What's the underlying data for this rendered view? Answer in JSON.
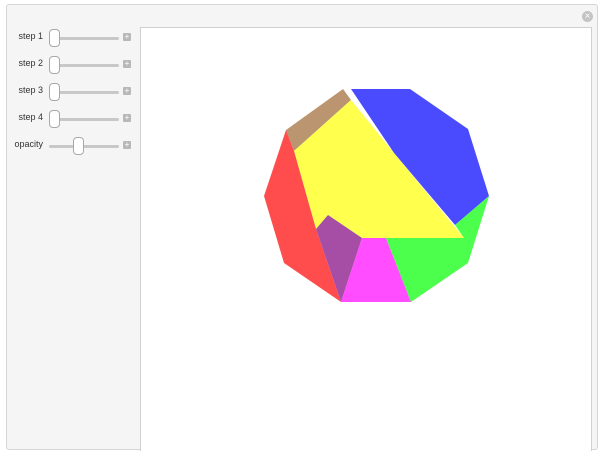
{
  "controls": [
    {
      "id": "step-1",
      "label": "step 1",
      "value": 0
    },
    {
      "id": "step-2",
      "label": "step 2",
      "value": 0
    },
    {
      "id": "step-3",
      "label": "step 3",
      "value": 0
    },
    {
      "id": "step-4",
      "label": "step 4",
      "value": 0
    },
    {
      "id": "opacity",
      "label": "opacity",
      "value": 0.4
    }
  ],
  "pieces": [
    {
      "name": "piece-blue",
      "color": "#4a4aff"
    },
    {
      "name": "piece-tan",
      "color": "#bb9570"
    },
    {
      "name": "piece-yellow",
      "color": "#ffff4d"
    },
    {
      "name": "piece-red",
      "color": "#ff4d4d"
    },
    {
      "name": "piece-purple",
      "color": "#a64da6"
    },
    {
      "name": "piece-magenta",
      "color": "#ff4dff"
    },
    {
      "name": "piece-green",
      "color": "#4dff4d"
    }
  ],
  "icons": {
    "close": "close-icon",
    "expand": "plus-icon"
  }
}
